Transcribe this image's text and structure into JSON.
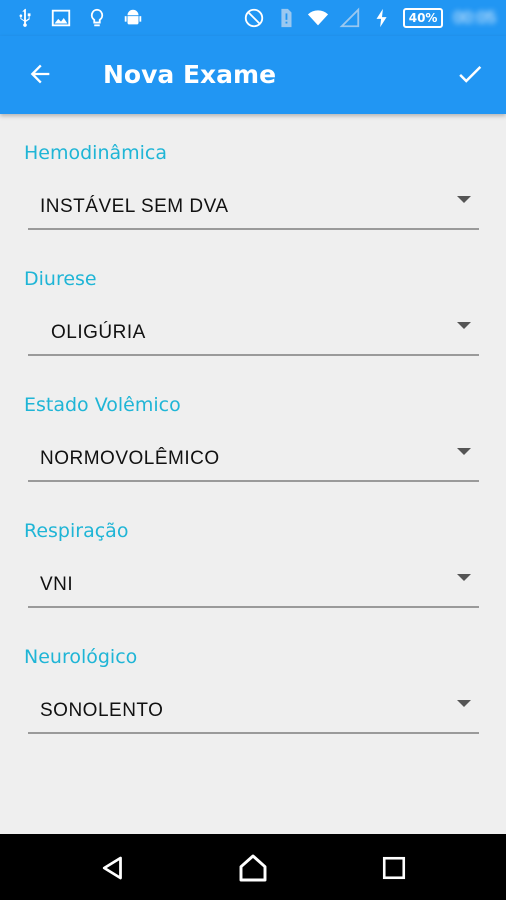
{
  "status_bar": {
    "battery": "40%",
    "time": "00:05"
  },
  "app_bar": {
    "title": "Nova Exame",
    "back_icon": "arrow-left-icon",
    "confirm_icon": "check-icon"
  },
  "fields": [
    {
      "label": "Hemodinâmica",
      "value": "INSTÁVEL SEM DVA"
    },
    {
      "label": "Diurese",
      "value": "OLIGÚRIA"
    },
    {
      "label": "Estado Volêmico",
      "value": "NORMOVOLÊMICO"
    },
    {
      "label": "Respiração",
      "value": "VNI"
    },
    {
      "label": "Neurológico",
      "value": "SONOLENTO"
    }
  ],
  "colors": {
    "primary": "#2196f3",
    "label": "#1fb5d6",
    "background": "#efefef"
  }
}
